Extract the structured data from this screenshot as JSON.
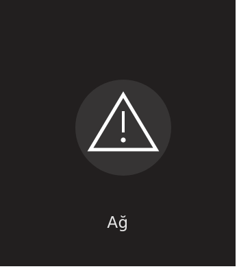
{
  "tile": {
    "icon": "warning-triangle-icon",
    "label": "Ağ",
    "colors": {
      "background": "#221f1f",
      "icon_circle": "#363434",
      "icon_stroke": "#ffffff",
      "label_text": "#e6e6e6"
    }
  }
}
